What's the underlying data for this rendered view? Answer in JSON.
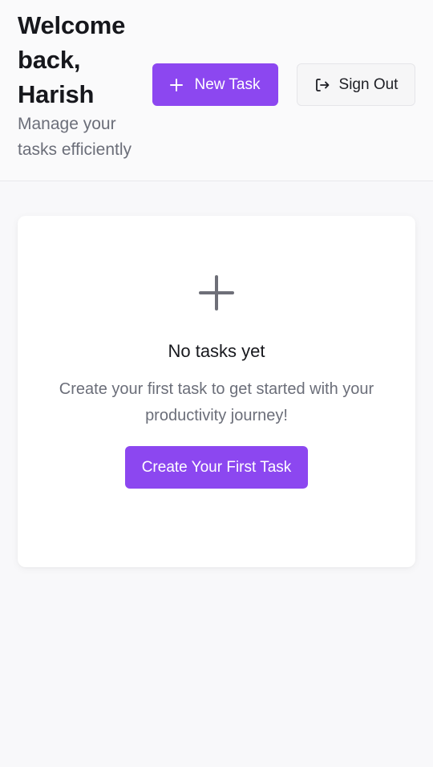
{
  "header": {
    "greeting": "Welcome back, Harish",
    "subtitle": "Manage your tasks efficiently",
    "new_task_label": "New Task",
    "sign_out_label": "Sign Out"
  },
  "empty_state": {
    "title": "No tasks yet",
    "description": "Create your first task to get started with your productivity journey!",
    "cta_label": "Create Your First Task"
  },
  "icons": {
    "new_task": "plus-icon",
    "sign_out": "sign-out-icon",
    "empty_state": "plus-icon"
  },
  "colors": {
    "accent": "#8c47f0",
    "background": "#f8f8fa",
    "card": "#ffffff",
    "text_primary": "#16171c",
    "text_secondary": "#6b6e79"
  }
}
